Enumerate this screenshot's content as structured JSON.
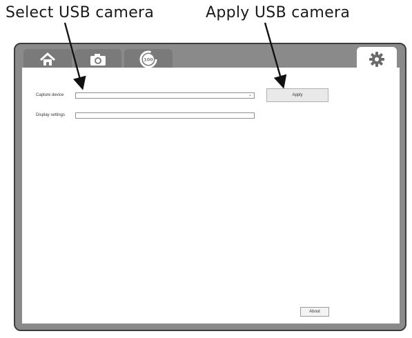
{
  "annotations": {
    "select": "Select USB camera",
    "apply": "Apply USB camera"
  },
  "tabs": [
    {
      "icon": "home-icon",
      "active": false
    },
    {
      "icon": "camera-icon",
      "active": false
    },
    {
      "icon": "timer-100-icon",
      "active": false
    },
    {
      "icon": "gear-icon",
      "active": true
    }
  ],
  "timer_icon_text": "100",
  "settings": {
    "capture_device_label": "Capture device",
    "capture_device_value": "",
    "display_settings_label": "Display settings",
    "display_settings_value": "",
    "apply_label": "Apply",
    "about_label": "About"
  },
  "colors": {
    "tab_inactive": "#7a7a7a",
    "frame": "#8a8a8a",
    "panel": "#ffffff"
  }
}
